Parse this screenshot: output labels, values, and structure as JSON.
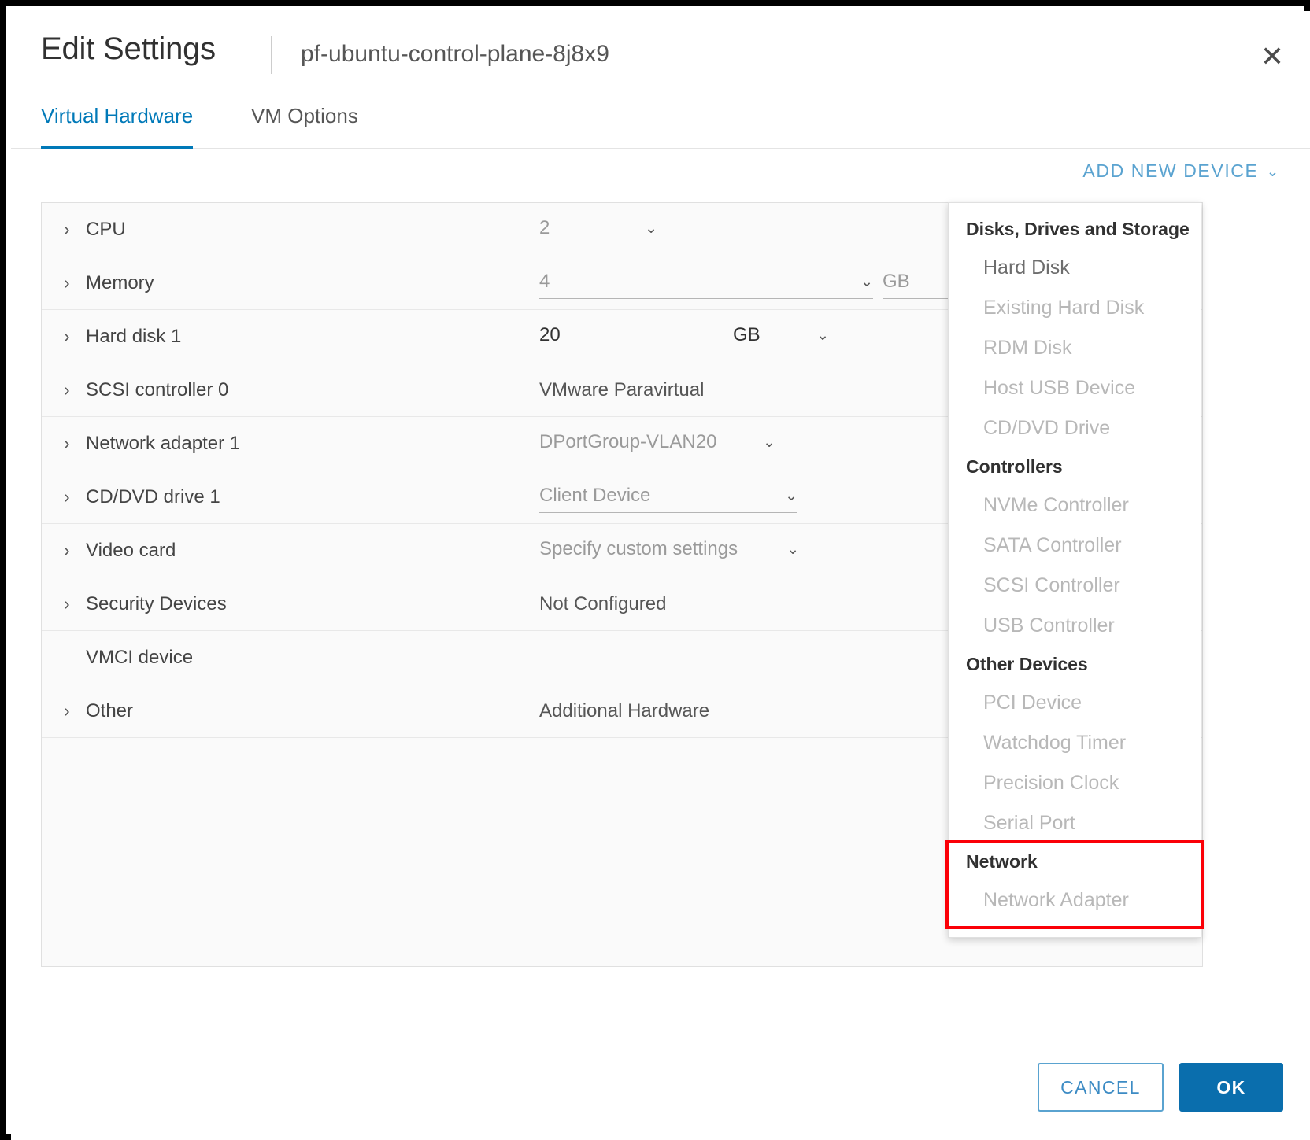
{
  "header": {
    "title": "Edit Settings",
    "vm_name": "pf-ubuntu-control-plane-8j8x9",
    "close_icon": "close-icon",
    "close_glyph": "✕"
  },
  "tabs": [
    {
      "label": "Virtual Hardware",
      "active": true
    },
    {
      "label": "VM Options",
      "active": false
    }
  ],
  "toolbar": {
    "add_new_device_label": "ADD NEW DEVICE",
    "chevron_glyph": "⌄"
  },
  "hardware": {
    "caret_glyph": "›",
    "caret_down_glyph": "⌄",
    "rows": [
      {
        "label": "CPU",
        "expandable": true,
        "value": "2",
        "kind": "select-sm",
        "unit": ""
      },
      {
        "label": "Memory",
        "expandable": true,
        "value": "4",
        "kind": "select-lg",
        "unit": "GB"
      },
      {
        "label": "Hard disk 1",
        "expandable": true,
        "value": "20",
        "kind": "input-unit",
        "unit": "GB"
      },
      {
        "label": "SCSI controller 0",
        "expandable": true,
        "value": "VMware Paravirtual",
        "kind": "text",
        "unit": ""
      },
      {
        "label": "Network adapter 1",
        "expandable": true,
        "value": "DPortGroup-VLAN20",
        "kind": "select-auto",
        "unit": ""
      },
      {
        "label": "CD/DVD drive 1",
        "expandable": true,
        "value": "Client Device",
        "kind": "select-med",
        "unit": ""
      },
      {
        "label": "Video card",
        "expandable": true,
        "value": "Specify custom settings",
        "kind": "select-auto",
        "unit": ""
      },
      {
        "label": "Security Devices",
        "expandable": true,
        "value": "Not Configured",
        "kind": "text",
        "unit": ""
      },
      {
        "label": "VMCI device",
        "expandable": false,
        "value": "",
        "kind": "none",
        "unit": ""
      },
      {
        "label": "Other",
        "expandable": true,
        "value": "Additional Hardware",
        "kind": "text",
        "unit": ""
      }
    ]
  },
  "add_device_menu": {
    "groups": [
      {
        "name": "Disks, Drives and Storage",
        "items": [
          {
            "label": "Hard Disk",
            "enabled": true,
            "highlighted": false
          },
          {
            "label": "Existing Hard Disk",
            "enabled": false,
            "highlighted": false
          },
          {
            "label": "RDM Disk",
            "enabled": false,
            "highlighted": false
          },
          {
            "label": "Host USB Device",
            "enabled": false,
            "highlighted": false
          },
          {
            "label": "CD/DVD Drive",
            "enabled": false,
            "highlighted": false
          }
        ]
      },
      {
        "name": "Controllers",
        "items": [
          {
            "label": "NVMe Controller",
            "enabled": false,
            "highlighted": false
          },
          {
            "label": "SATA Controller",
            "enabled": false,
            "highlighted": false
          },
          {
            "label": "SCSI Controller",
            "enabled": false,
            "highlighted": false
          },
          {
            "label": "USB Controller",
            "enabled": false,
            "highlighted": false
          }
        ]
      },
      {
        "name": "Other Devices",
        "items": [
          {
            "label": "PCI Device",
            "enabled": false,
            "highlighted": false
          },
          {
            "label": "Watchdog Timer",
            "enabled": false,
            "highlighted": false
          },
          {
            "label": "Precision Clock",
            "enabled": false,
            "highlighted": false
          },
          {
            "label": "Serial Port",
            "enabled": false,
            "highlighted": false
          }
        ]
      },
      {
        "name": "Network",
        "highlighted": true,
        "items": [
          {
            "label": "Network Adapter",
            "enabled": false,
            "highlighted": true
          }
        ]
      }
    ]
  },
  "footer": {
    "cancel_label": "CANCEL",
    "ok_label": "OK"
  },
  "colors": {
    "accent": "#0079b8",
    "link": "#5aa3d0",
    "ok_button": "#0a6ead",
    "highlight_red": "#fb0007",
    "text": "#313131",
    "muted": "#9a9a9a",
    "disabled": "#b8b8b8"
  }
}
